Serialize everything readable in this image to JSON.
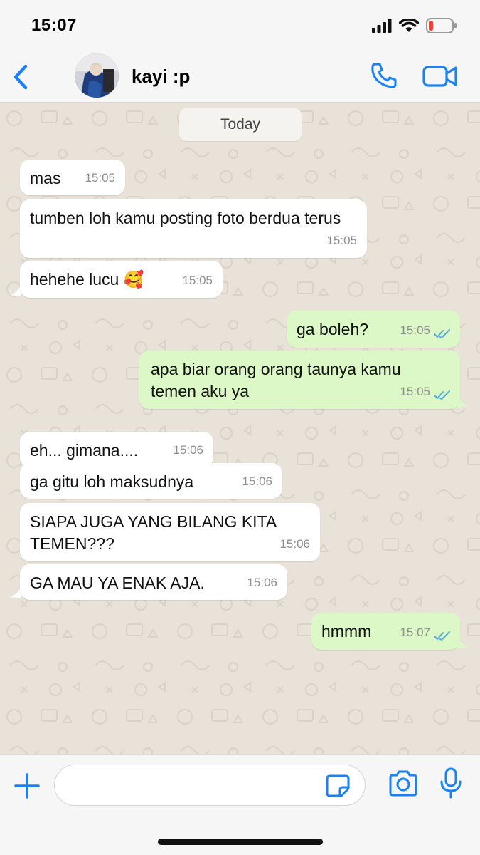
{
  "status_bar": {
    "time": "15:07",
    "icons": [
      "signal-icon",
      "wifi-icon",
      "battery-icon"
    ],
    "battery_color": "#ff3b30"
  },
  "header": {
    "back_icon": "chevron-left-icon",
    "contact_name": "kayi :p",
    "call_icon": "phone-icon",
    "video_icon": "video-camera-icon",
    "accent_color": "#1a82f7"
  },
  "chat": {
    "date_label": "Today",
    "messages": [
      {
        "direction": "in",
        "text": "mas",
        "time": "15:05"
      },
      {
        "direction": "in",
        "text": "tumben loh kamu posting foto berdua terus",
        "time": "15:05"
      },
      {
        "direction": "in",
        "text": "hehehe lucu 🥰",
        "time": "15:05"
      },
      {
        "direction": "out",
        "text": "ga boleh?",
        "time": "15:05",
        "status": "read"
      },
      {
        "direction": "out",
        "text": "apa biar orang orang taunya kamu temen aku ya",
        "time": "15:05",
        "status": "read"
      },
      {
        "direction": "in",
        "text": "eh... gimana....",
        "time": "15:06"
      },
      {
        "direction": "in",
        "text": "ga gitu loh maksudnya",
        "time": "15:06"
      },
      {
        "direction": "in",
        "text": "SIAPA JUGA YANG BILANG KITA TEMEN???",
        "time": "15:06"
      },
      {
        "direction": "in",
        "text": "GA MAU YA ENAK AJA.",
        "time": "15:06"
      },
      {
        "direction": "out",
        "text": "hmmm",
        "time": "15:07",
        "status": "read"
      }
    ],
    "incoming_bubble_color": "#ffffff",
    "outgoing_bubble_color": "#dcf8c6",
    "read_tick_color": "#4fa9e6"
  },
  "composer": {
    "plus_icon": "plus-icon",
    "input_value": "",
    "sticker_icon": "sticker-icon",
    "camera_icon": "camera-icon",
    "mic_icon": "microphone-icon"
  }
}
